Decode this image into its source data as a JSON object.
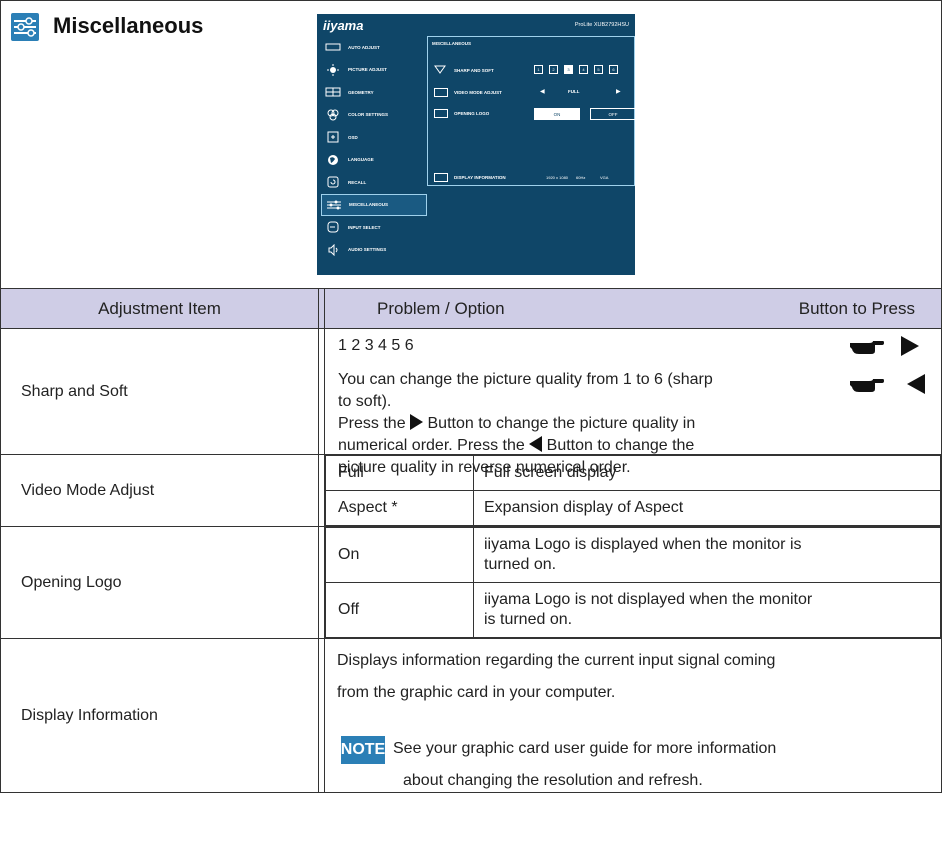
{
  "section": {
    "icon": "sliders-icon",
    "title": "Miscellaneous"
  },
  "osd": {
    "brand": "iiyama",
    "model": "ProLite XUB2792HSU",
    "menu": [
      {
        "label": "AUTO ADJUST",
        "icon": "auto-adjust-icon"
      },
      {
        "label": "PICTURE ADJUST",
        "icon": "picture-adjust-icon"
      },
      {
        "label": "GEOMETRY",
        "icon": "geometry-icon"
      },
      {
        "label": "COLOR SETTINGS",
        "icon": "color-settings-icon"
      },
      {
        "label": "OSD",
        "icon": "osd-icon"
      },
      {
        "label": "LANGUAGE",
        "icon": "globe-icon"
      },
      {
        "label": "RECALL",
        "icon": "recall-icon"
      },
      {
        "label": "MISCELLANEOUS",
        "icon": "sliders-icon"
      },
      {
        "label": "INPUT SELECT",
        "icon": "input-select-icon"
      },
      {
        "label": "AUDIO SETTINGS",
        "icon": "speaker-icon"
      }
    ],
    "active_menu": "MISCELLANEOUS",
    "panel_title": "MISCELLANEOUS",
    "sharp_label": "SHARP AND SOFT",
    "sharp_values": [
      "1",
      "2",
      "3",
      "4",
      "5",
      "6"
    ],
    "sharp_selected": "3",
    "video_label": "VIDEO MODE ADJUST",
    "video_value": "FULL",
    "logo_label": "OPENING LOGO",
    "logo_on": "ON",
    "logo_off": "OFF",
    "info_label": "DISPLAY INFORMATION",
    "info_resolution": "1920 x 1080",
    "info_refresh": "60Hz",
    "info_input": "VGA"
  },
  "table": {
    "headers": {
      "item": "Adjustment Item",
      "option": "Problem / Option",
      "button": "Button to Press"
    },
    "sharp": {
      "item": "Sharp and Soft",
      "values_line": "1 2 3 4 5 6",
      "desc1": "You can change the picture quality from 1 to 6 (sharp",
      "desc2": "to soft).",
      "desc3a": "Press the",
      "desc3b": "Button to change the picture quality in",
      "desc4a": "numerical order. Press the",
      "desc4b": "Button to change the",
      "desc5": "picture quality in reverse numerical order."
    },
    "video": {
      "item": "Video Mode Adjust",
      "options": [
        {
          "name": "Full",
          "desc": "Full screen display"
        },
        {
          "name": "Aspect *",
          "desc": "Expansion display of Aspect"
        }
      ]
    },
    "logo": {
      "item": "Opening Logo",
      "options": [
        {
          "name": "On",
          "desc1": "iiyama Logo is displayed when the monitor is",
          "desc2": "turned on."
        },
        {
          "name": "Off",
          "desc1": "iiyama Logo is not displayed when the monitor",
          "desc2": "is turned on."
        }
      ]
    },
    "info": {
      "item": "Display Information",
      "text1": "Displays information regarding the current input signal coming",
      "text2": "from the graphic card in your computer.",
      "note_label": "NOTE",
      "note1": "See your graphic card user guide for more information",
      "note2": "about changing the resolution and refresh."
    }
  },
  "colors": {
    "header_bg": "#cfcde6",
    "accent": "#2b7fb6",
    "osd_bg": "#0f4668"
  }
}
